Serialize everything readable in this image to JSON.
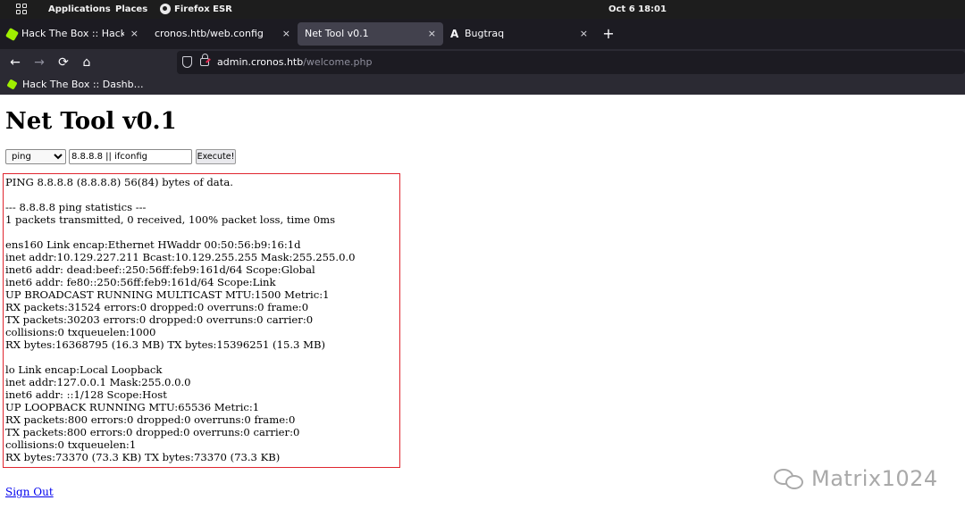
{
  "topbar": {
    "applications": "Applications",
    "places": "Places",
    "browser": "Firefox ESR",
    "clock": "Oct 6  18:01"
  },
  "tabs": [
    {
      "label": "Hack The Box :: Hack The",
      "icon": "htb-cube-icon",
      "active": false
    },
    {
      "label": "cronos.htb/web.config",
      "icon": "",
      "active": false
    },
    {
      "label": "Net Tool v0.1",
      "icon": "",
      "active": true
    },
    {
      "label": "Bugtraq",
      "icon": "bugtraq-icon",
      "active": false
    }
  ],
  "tab_close": "×",
  "new_tab": "+",
  "nav": {
    "back": "←",
    "forward": "→",
    "reload": "⟳",
    "home": "⌂",
    "url_host": "admin.cronos.htb",
    "url_path": "/welcome.php"
  },
  "bookmarks": [
    {
      "label": "Hack The Box :: Dashb…"
    }
  ],
  "page": {
    "title": "Net Tool v0.1",
    "command_select": "ping",
    "command_input": "8.8.8.8 || ifconfig",
    "execute_button": "Execute!",
    "output": "PING 8.8.8.8 (8.8.8.8) 56(84) bytes of data.\n\n--- 8.8.8.8 ping statistics ---\n1 packets transmitted, 0 received, 100% packet loss, time 0ms\n\nens160 Link encap:Ethernet HWaddr 00:50:56:b9:16:1d\ninet addr:10.129.227.211 Bcast:10.129.255.255 Mask:255.255.0.0\ninet6 addr: dead:beef::250:56ff:feb9:161d/64 Scope:Global\ninet6 addr: fe80::250:56ff:feb9:161d/64 Scope:Link\nUP BROADCAST RUNNING MULTICAST MTU:1500 Metric:1\nRX packets:31524 errors:0 dropped:0 overruns:0 frame:0\nTX packets:30203 errors:0 dropped:0 overruns:0 carrier:0\ncollisions:0 txqueuelen:1000\nRX bytes:16368795 (16.3 MB) TX bytes:15396251 (15.3 MB)\n\nlo Link encap:Local Loopback\ninet addr:127.0.0.1 Mask:255.0.0.0\ninet6 addr: ::1/128 Scope:Host\nUP LOOPBACK RUNNING MTU:65536 Metric:1\nRX packets:800 errors:0 dropped:0 overruns:0 frame:0\nTX packets:800 errors:0 dropped:0 overruns:0 carrier:0\ncollisions:0 txqueuelen:1\nRX bytes:73370 (73.3 KB) TX bytes:73370 (73.3 KB)",
    "sign_out": "Sign Out"
  },
  "watermark": "Matrix1024",
  "colors": {
    "topbar": "#1d1d1d",
    "tabstrip": "#1c1b22",
    "active_tab": "#42414d",
    "toolbar": "#2b2a33",
    "htb_green": "#9fef00",
    "highlight_border": "#e0262f",
    "link": "#0000ee"
  }
}
